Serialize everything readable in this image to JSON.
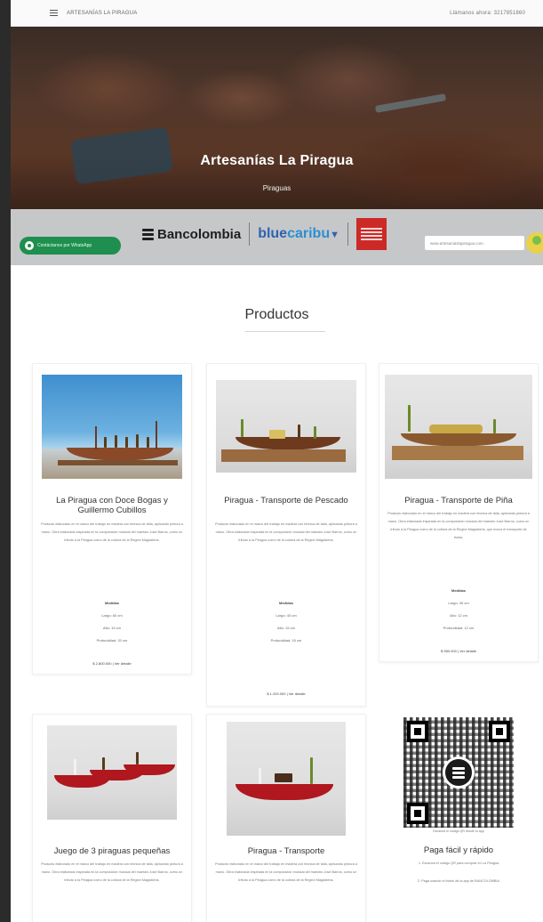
{
  "topbar": {
    "brand": "ARTESANÍAS LA PIRAGUA",
    "phone": "Llámanos ahora: 3217851860"
  },
  "hero": {
    "title": "Artesanías La Piragua",
    "subtitle": "Piraguas"
  },
  "band": {
    "whatsapp_label": "Contáctanos por WhatsApp",
    "bancolombia": "Bancolombia",
    "bluecaribu_a": "blue",
    "bluecaribu_b": "caribu",
    "search_value": "www.artesaniaslapiragua.com"
  },
  "products_title": "Productos",
  "products": [
    {
      "title": "La Piragua con Doce Bogas y Guillermo Cubillos",
      "desc": "Producto elaborado en el marco del trabajo en madera con técnica de talla, aplicando pintura a mano. Obra elaborada inspirada en la composición musical del maestro José Barros, como un tributo a la Piragua como de la cultura de la Región Magdalena.",
      "meas_title": "Medidas",
      "largo": "Largo: 60 cm",
      "ancho": "Alto: 15 cm",
      "prof": "Profundidad: 20 cm",
      "price": "$ 2.800.000 | Ver detalle"
    },
    {
      "title": "Piragua - Transporte de Pescado",
      "desc": "Producto elaborado en el marco del trabajo en madera con técnica de talla, aplicando pintura a mano. Obra elaborada inspirada en la composición musical del maestro José Barros, como un tributo a la Piragua como de la cultura de la Región Magdalena.",
      "meas_title": "Medidas",
      "largo": "Largo: 40 cm",
      "ancho": "Alto: 15 cm",
      "prof": "Profundidad: 15 cm",
      "price": "$ 1.200.000 | Ver detalle"
    },
    {
      "title": "Piragua - Transporte de Piña",
      "desc": "Producto elaborado en el marco del trabajo en madera con técnica de talla, aplicando pintura a mano. Obra elaborada inspirada en la composición musical del maestro José Barros, como un tributo a la Piragua como de la cultura de la Región Magdalena, que evoca el transporte de frutas.",
      "meas_title": "Medidas",
      "largo": "Largo: 35 cm",
      "ancho": "Alto: 12 cm",
      "prof": "Profundidad: 12 cm",
      "price": "$ 950.000 | Ver detalle"
    },
    {
      "title": "Juego de 3 piraguas pequeñas",
      "desc": "Producto elaborado en el marco del trabajo en madera con técnica de talla, aplicando pintura a mano. Obra elaborada inspirada en la composición musical del maestro José Barros, como un tributo a la Piragua como de la cultura de la Región Magdalena."
    },
    {
      "title": "Piragua - Transporte",
      "desc": "Producto elaborado en el marco del trabajo en madera con técnica de talla, aplicando pintura a mano. Obra elaborada inspirada en la composición musical del maestro José Barros, como un tributo a la Piragua como de la cultura de la Región Magdalena."
    }
  ],
  "payment": {
    "qr_caption": "Escanea el código QR desde tu app",
    "title": "Paga fácil y rápido",
    "line1": "1. Escanea el código QR para comprar en La Piragua",
    "line2": "2. Paga usando el botón de la app de BANCOLOMBIA"
  },
  "colors": {
    "whatsapp": "#1e8f4e",
    "bluecaribu": "#2e63b4",
    "band": "#c6c7c9"
  }
}
